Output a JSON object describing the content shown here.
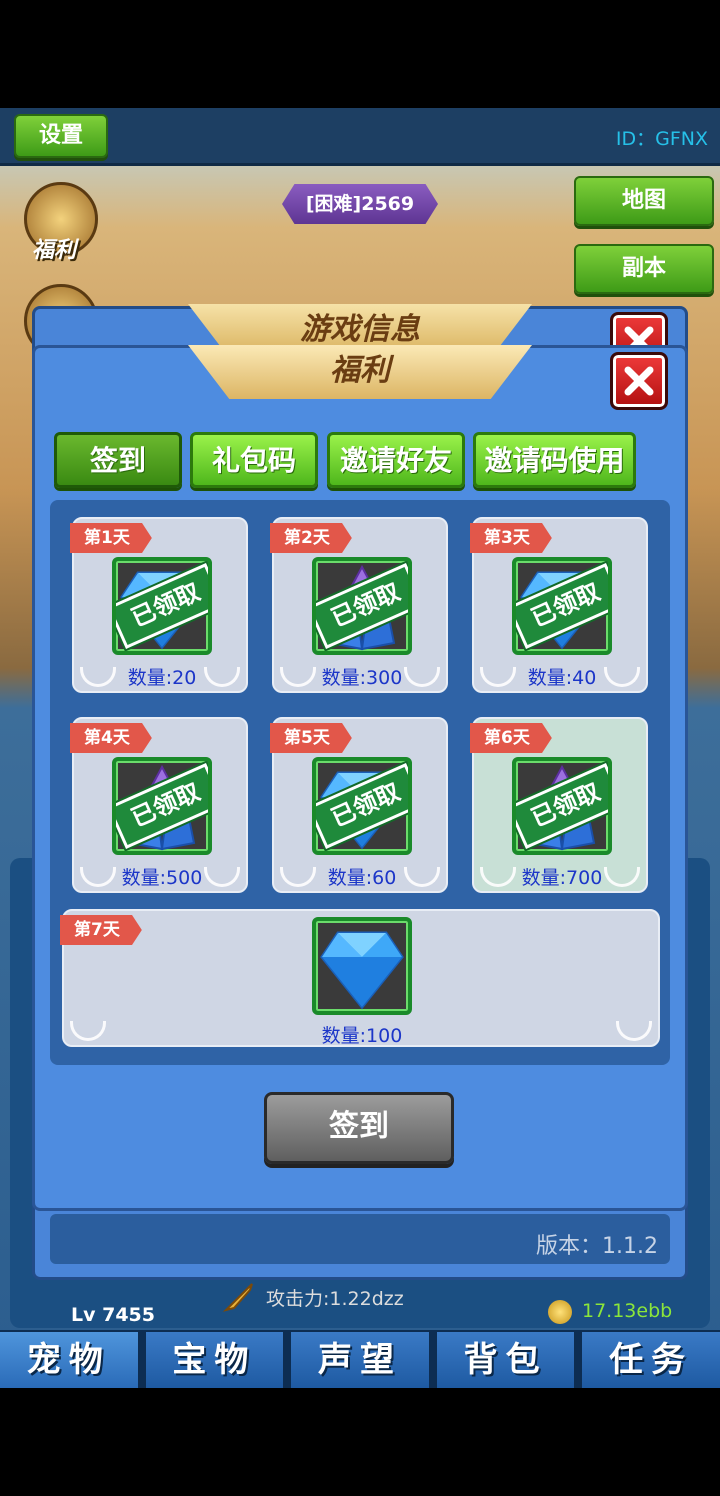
{
  "topbar": {
    "settings_label": "设置",
    "player_id": "ID：GFNX"
  },
  "stage": {
    "label": "[困难]2569"
  },
  "side_buttons": {
    "map_label": "地图",
    "dungeon_label": "副本",
    "welfare_label": "福利"
  },
  "background": {
    "level": "Lv 7455",
    "attack": "攻击力:1.22dzz",
    "gold": "17.13ebb"
  },
  "game_info_dialog": {
    "title": "游戏信息",
    "version": "版本：1.1.2"
  },
  "welfare_dialog": {
    "title": "福利",
    "tabs": [
      {
        "label": "签到",
        "active": true
      },
      {
        "label": "礼包码",
        "active": false
      },
      {
        "label": "邀请好友",
        "active": false
      },
      {
        "label": "邀请码使用",
        "active": false
      }
    ],
    "claimed_stamp": "已领取",
    "days": [
      {
        "day": "第1天",
        "quantity": "数量:20",
        "item": "blue-diamond-icon",
        "claimed": true
      },
      {
        "day": "第2天",
        "quantity": "数量:300",
        "item": "purple-crystal-icon",
        "claimed": true
      },
      {
        "day": "第3天",
        "quantity": "数量:40",
        "item": "blue-diamond-icon",
        "claimed": true
      },
      {
        "day": "第4天",
        "quantity": "数量:500",
        "item": "purple-crystal-icon",
        "claimed": true
      },
      {
        "day": "第5天",
        "quantity": "数量:60",
        "item": "blue-diamond-icon",
        "claimed": true
      },
      {
        "day": "第6天",
        "quantity": "数量:700",
        "item": "purple-crystal-icon",
        "claimed": true
      },
      {
        "day": "第7天",
        "quantity": "数量:100",
        "item": "blue-diamond-icon",
        "claimed": false
      }
    ],
    "sign_button": "签到"
  },
  "bottom_tabs": [
    {
      "label": "宠物"
    },
    {
      "label": "宝物"
    },
    {
      "label": "声望"
    },
    {
      "label": "背包"
    },
    {
      "label": "任务"
    }
  ],
  "colors": {
    "accent_green": "#4fb71c",
    "dialog_blue": "#4e8ce0",
    "quantity_text": "#1c36c8",
    "close_red": "#d42222"
  }
}
